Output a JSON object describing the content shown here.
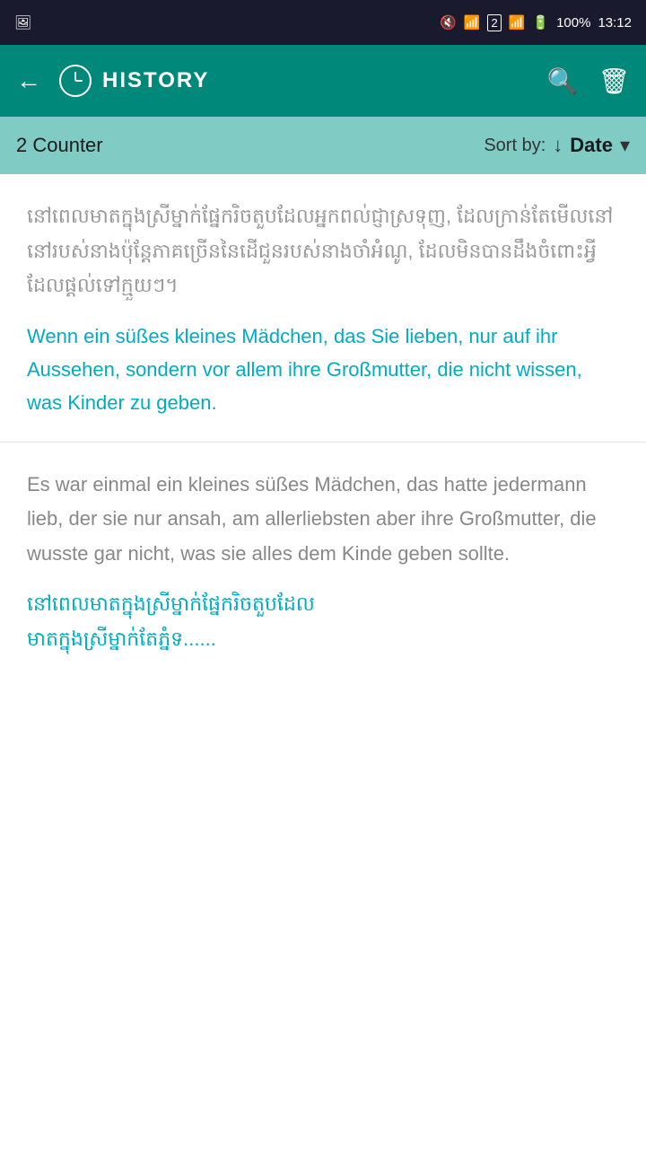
{
  "statusBar": {
    "leftIcon": "image-icon",
    "centerIcons": [
      "mute-icon",
      "download-icon",
      "sim2-icon",
      "signal-icon",
      "signal-bars-icon"
    ],
    "battery": "100%",
    "time": "13:12"
  },
  "toolbar": {
    "backLabel": "←",
    "clockIcon": "clock-icon",
    "title": "HISTORY",
    "searchIcon": "search-icon",
    "deleteIcon": "delete-icon"
  },
  "subheader": {
    "counter": "2 Counter",
    "sortLabel": "Sort by:",
    "sortArrow": "↓",
    "sortValue": "Date",
    "dropdownIcon": "▾"
  },
  "cards": [
    {
      "id": "card-1",
      "khmerText": "នៅពេលមាតក្នុងស្រីម្នាក់ផ្នែករិចតួបដែលអ្នកពល់ជ្ញាស្រទុញ, ដែលក្រាន់តែមើលនៅនៅរបស់នាងប៉ុន្តែភាគច្រើននៃដើជួនរបស់នាងចាំអំណូ, ដែលមិនបានដឹងចំពោះអ្វីដែលផ្ដល់ទៅក្មួយៗ។",
      "germanTextTeal": "Wenn ein süßes kleines Mädchen, das Sie lieben, nur auf ihr Aussehen, sondern vor allem ihre Großmutter, die nicht wissen, was Kinder zu geben."
    },
    {
      "id": "card-2",
      "germanTextGray": "Es war einmal ein kleines süßes Mädchen, das hatte jedermann lieb, der sie nur ansah, am allerliebsten aber ihre Großmutter, die wusste gar nicht, was sie alles dem Kinde geben sollte.",
      "khmerTextTeal": "នៅពេលមាតក្នុងស្រីម្នាក់ផ្នែករិចតួបដែល"
    }
  ]
}
